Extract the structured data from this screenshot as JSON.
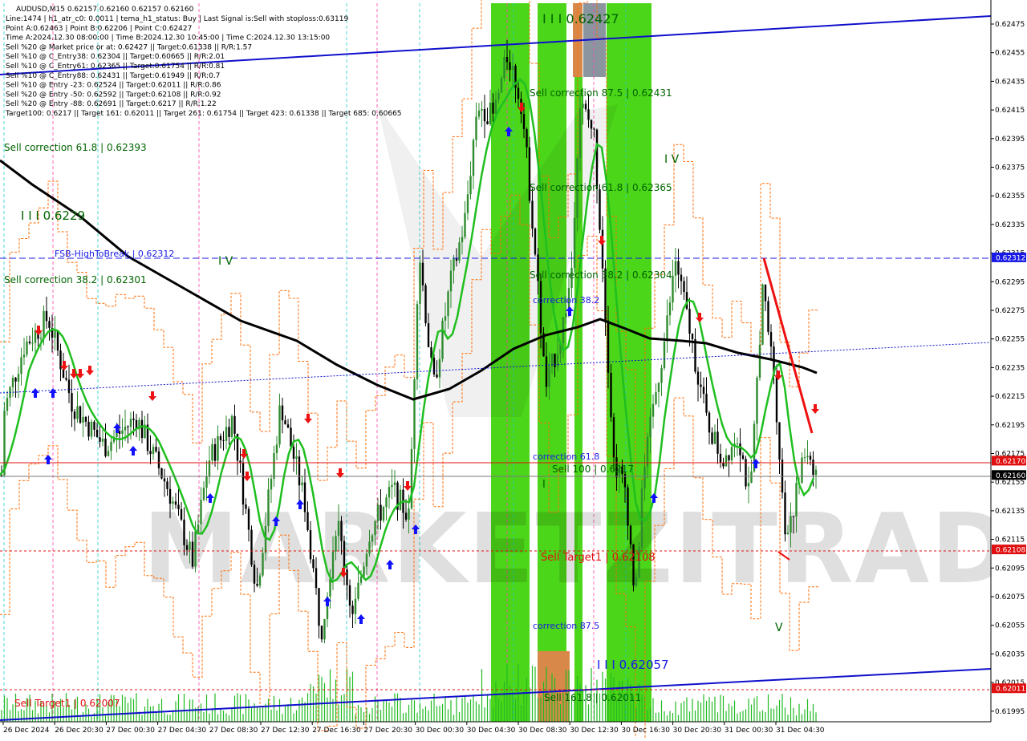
{
  "chart_data": {
    "type": "candlestick",
    "symbol_line": "AUDUSD,M15  0.62157 0.62160 0.62157 0.62160",
    "info_lines": [
      "Line:1474  |  h1_atr_c0: 0.0011  |  tema_h1_status: Buy  |  Last Signal is:Sell with stoploss:0.63119",
      "Point A:0.62463  |  Point B:0.62206  |  Point C:0.62427",
      "Time A:2024.12.30 08:00:00  |  Time B:2024.12.30 10:45:00  |  Time C:2024.12.30 13:15:00",
      "Sell %20 @ Market price or at: 0.62427  ||  Target:0.61338  ||  R/R:1.57",
      "Sell %10 @ C_Entry38: 0.62304  ||  Target:0.60665  ||  R/R:2.01",
      "Sell %10 @ C_Entry61: 0.62365  ||  Target:0.61754  ||  R/R:0.81",
      "Sell %10 @ C_Entry88: 0.62431  ||  Target:0.61949  ||  R/R:0.7",
      "Sell %10 @ Entry -23: 0.62524  ||  Target:0.62011  ||  R/R:0.86",
      "Sell %20 @ Entry -50: 0.62592  ||  Target:0.62108  ||  R/R:0.92",
      "Sell %20 @ Entry -88: 0.62691  ||  Target:0.6217  ||  R/R:1.22",
      "Target100: 0.6217  ||  Target 161: 0.62011  ||  Target 261: 0.61754  ||  Target 423: 0.61338  ||  Target 685: 0.60665"
    ],
    "y_range": [
      0.61985,
      0.62495
    ],
    "y_ticks": [
      "0.62475",
      "0.62455",
      "0.62435",
      "0.62415",
      "0.62395",
      "0.62375",
      "0.62355",
      "0.62335",
      "0.62315",
      "0.62295",
      "0.62275",
      "0.62255",
      "0.62235",
      "0.62215",
      "0.62195",
      "0.62175",
      "0.62155",
      "0.62135",
      "0.62115",
      "0.62095",
      "0.62075",
      "0.62055",
      "0.62035",
      "0.62015",
      "0.61995"
    ],
    "x_labels": [
      "26 Dec 2024",
      "26 Dec 20:30",
      "27 Dec 00:30",
      "27 Dec 04:30",
      "27 Dec 08:30",
      "27 Dec 12:30",
      "27 Dec 16:30",
      "27 Dec 20:30",
      "30 Dec 00:30",
      "30 Dec 04:30",
      "30 Dec 08:30",
      "30 Dec 12:30",
      "30 Dec 16:30",
      "30 Dec 20:30",
      "31 Dec 00:30",
      "31 Dec 04:30"
    ],
    "price_tags": [
      {
        "value": "0.62312",
        "color": "#1a1ae6"
      },
      {
        "value": "0.62170",
        "color": "#e01010"
      },
      {
        "value": "0.62160",
        "color": "#000000"
      },
      {
        "value": "0.62108",
        "color": "#e01010"
      },
      {
        "value": "0.62011",
        "color": "#e01010"
      }
    ],
    "level_labels": [
      {
        "text": "FSB-HighToBreak  |  0.62312",
        "color": "#1a1ae6"
      },
      {
        "text": "Sell correction 61.8  |  0.62393",
        "color": "#006400"
      },
      {
        "text": "Sell correction 38.2  |  0.62301",
        "color": "#006400"
      },
      {
        "text": "I I I 0.6229",
        "color": "#006400"
      },
      {
        "text": "I V",
        "color": "#006400"
      },
      {
        "text": "I I I 0.62427",
        "color": "#006400"
      },
      {
        "text": "Sell correction 87.5  |  0.62431",
        "color": "#006400"
      },
      {
        "text": "Sell correction 61.8  |  0.62365",
        "color": "#006400"
      },
      {
        "text": "Sell correction 38.2  |  0.62304",
        "color": "#006400"
      },
      {
        "text": "correction 38.2",
        "color": "#1a1ae6"
      },
      {
        "text": "correction 61.8",
        "color": "#1a1ae6"
      },
      {
        "text": "Sell 100  |  0.6217",
        "color": "#006400"
      },
      {
        "text": "I",
        "color": "#006400"
      },
      {
        "text": "Sell Target1  |  0.62108",
        "color": "#e01010"
      },
      {
        "text": "correction 87.5",
        "color": "#1a1ae6"
      },
      {
        "text": "I I I 0.62057",
        "color": "#1a1ae6"
      },
      {
        "text": "Sell 161.8  |  0.62011",
        "color": "#006400"
      },
      {
        "text": "I V",
        "color": "#006400"
      },
      {
        "text": "V",
        "color": "#006400"
      },
      {
        "text": "Sell Target1  |  0.62007",
        "color": "#e01010"
      }
    ],
    "watermark": "MARKETZITRADE",
    "colors": {
      "bull": "#2e8b2e",
      "bear": "#000000",
      "ma_green": "#1fbf1f",
      "ma_black": "#000000",
      "band": "#ff6a00",
      "zone": "#33dd00",
      "channel": "#1010cc",
      "trend_red": "#ee1111"
    }
  }
}
